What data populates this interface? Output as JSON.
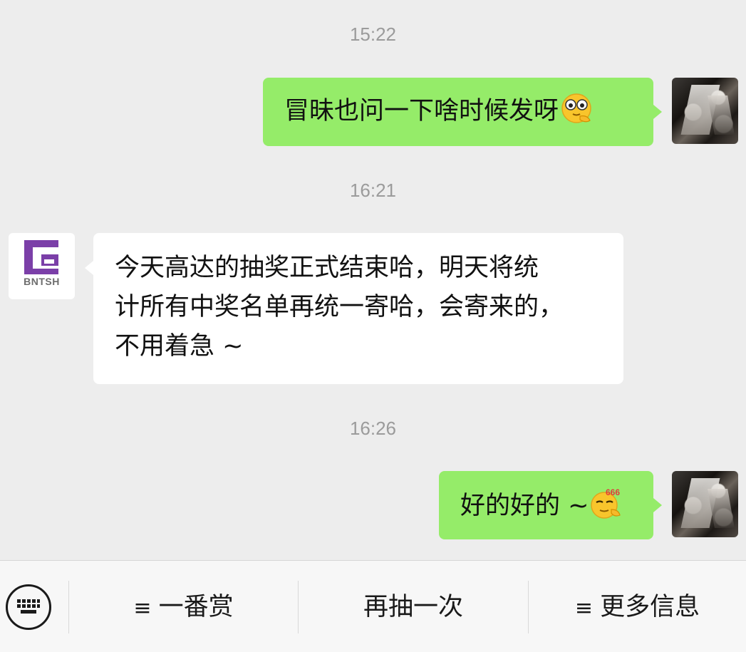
{
  "messages": {
    "ts1": "15:22",
    "msg1": "冒昧也问一下啥时候发呀",
    "ts2": "16:21",
    "msg2_lines": [
      "今天高达的抽奖正式结束哈，明天将统",
      "计所有中奖名单再统一寄哈，会寄来的，",
      "不用着急 ~"
    ],
    "ts3": "16:26",
    "msg3": "好的好的 ~",
    "emoji1": "thinking-emoji",
    "emoji2": "666-cool-emoji"
  },
  "brand": {
    "name": "BNTSH",
    "color": "#7b3fa8"
  },
  "bottom_bar": {
    "keyboard_icon": "keyboard-icon",
    "menu1": "一番赏",
    "menu2": "再抽一次",
    "menu3": "更多信息",
    "menu_icon": "≡"
  },
  "colors": {
    "my_bubble": "#95ec69",
    "other_bubble": "#ffffff",
    "background": "#ededed"
  }
}
